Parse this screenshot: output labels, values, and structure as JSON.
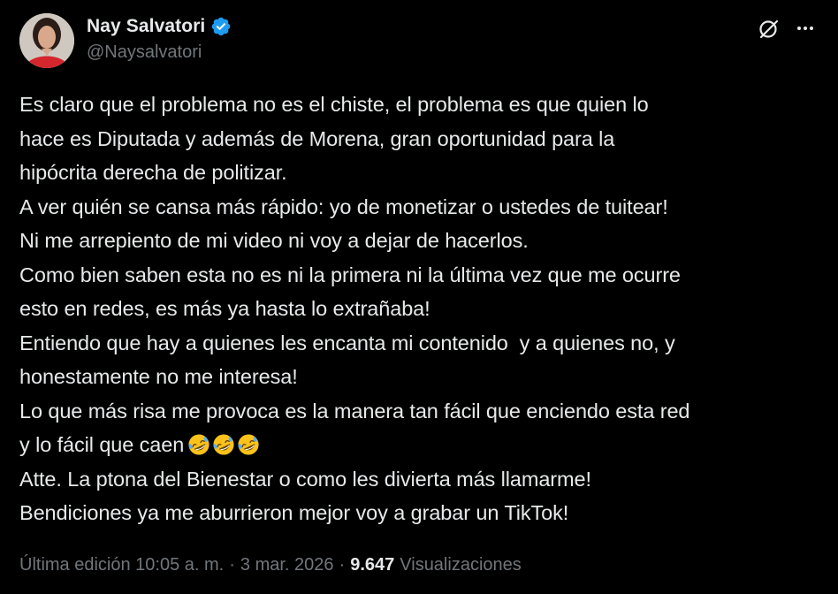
{
  "author": {
    "display_name": "Nay Salvatori",
    "handle": "@Naysalvatori",
    "verified": true,
    "verified_color": "#1d9bf0"
  },
  "icons": {
    "grok": "grok-icon",
    "more": "more-icon",
    "verified": "verified-badge-icon"
  },
  "tweet": {
    "lines": [
      "Es claro que el problema no es el chiste, el problema es que quien lo",
      "hace es Diputada y además de Morena, gran oportunidad para la",
      "hipócrita derecha de politizar.",
      "A ver quién se cansa más rápido: yo de monetizar o ustedes de tuitear!",
      "Ni me arrepiento de mi video ni voy a dejar de hacerlos.",
      "Como bien saben esta no es ni la primera ni la última vez que me ocurre",
      "esto en redes, es más ya hasta lo extrañaba!",
      "Entiendo que hay a quienes les encanta mi contenido  y a quienes no, y",
      "honestamente no me interesa!",
      "Lo que más risa me provoca es la manera tan fácil que enciendo esta red",
      "y lo fácil que caen",
      "Atte. La ptona del Bienestar o como les divierta más llamarme!",
      "Bendiciones ya me aburrieron mejor voy a grabar un TikTok!"
    ],
    "emoji": [
      "🤣",
      "🤣",
      "🤣"
    ]
  },
  "meta": {
    "edited_label": "Última edición 10:05 a. m.",
    "separator": "·",
    "date": "3 mar. 2026",
    "views_count": "9.647",
    "views_label": "Visualizaciones"
  },
  "colors": {
    "background": "#000000",
    "text_primary": "#e7e9ea",
    "text_secondary": "#71767b"
  }
}
